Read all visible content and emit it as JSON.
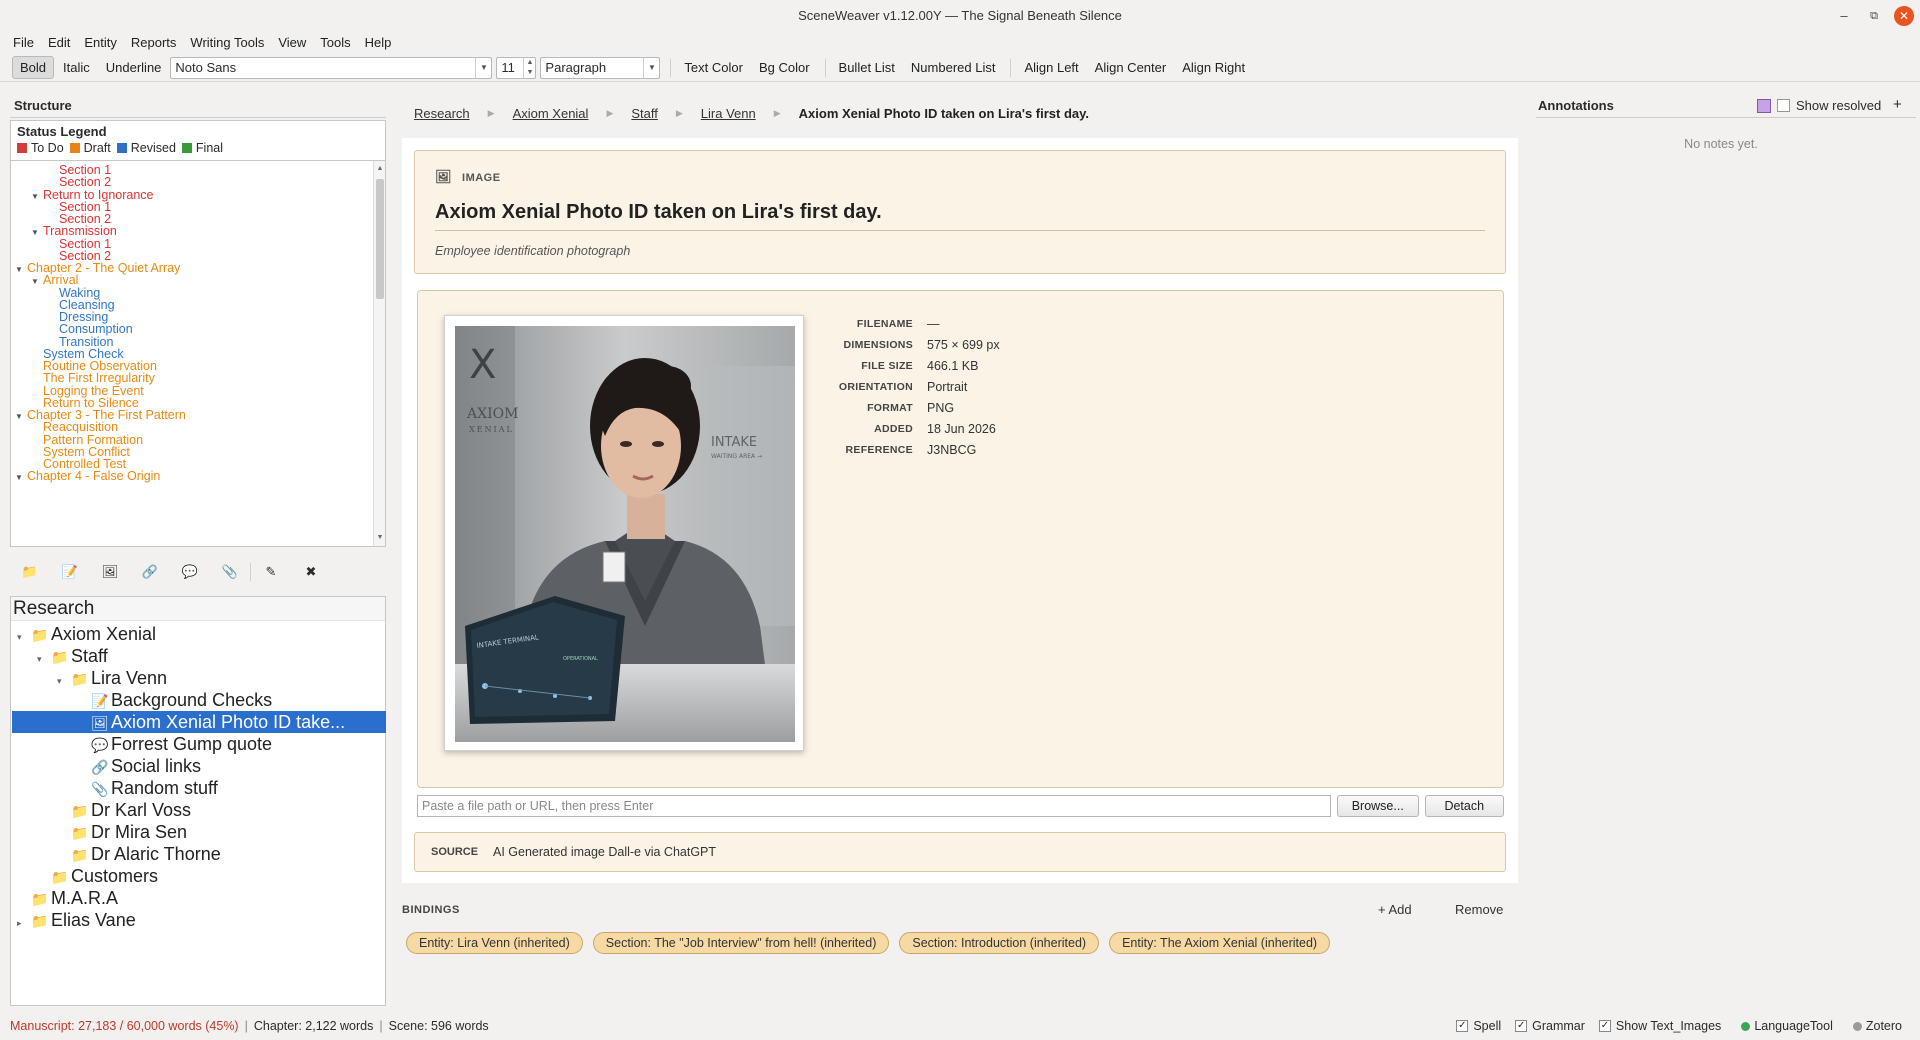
{
  "window": {
    "title": "SceneWeaver v1.12.00Y — The Signal Beneath Silence",
    "minimize": "–",
    "maximize": "⧉",
    "close": "✕"
  },
  "menu": [
    "File",
    "Edit",
    "Entity",
    "Reports",
    "Writing Tools",
    "View",
    "Tools",
    "Help"
  ],
  "toolbar": {
    "bold": "Bold",
    "italic": "Italic",
    "underline": "Underline",
    "font": "Noto Sans",
    "size": "11",
    "style": "Paragraph",
    "text_color": "Text Color",
    "bg_color": "Bg Color",
    "bullet_list": "Bullet List",
    "numbered_list": "Numbered List",
    "align_left": "Align Left",
    "align_center": "Align Center",
    "align_right": "Align Right"
  },
  "structure": {
    "header": "Structure",
    "legend_title": "Status Legend",
    "legend": [
      {
        "label": "To Do",
        "color": "#d33c3c"
      },
      {
        "label": "Draft",
        "color": "#e8821a"
      },
      {
        "label": "Revised",
        "color": "#2f6fc4"
      },
      {
        "label": "Final",
        "color": "#3a9a3a"
      }
    ],
    "items": [
      {
        "label": "Section 1",
        "level": 3,
        "color": "red",
        "expander": false
      },
      {
        "label": "Section 2",
        "level": 3,
        "color": "red",
        "expander": false
      },
      {
        "label": "Return to Ignorance",
        "level": 2,
        "color": "red",
        "expander": true
      },
      {
        "label": "Section 1",
        "level": 3,
        "color": "red",
        "expander": false
      },
      {
        "label": "Section 2",
        "level": 3,
        "color": "red",
        "expander": false
      },
      {
        "label": "Transmission",
        "level": 2,
        "color": "red",
        "expander": true
      },
      {
        "label": "Section 1",
        "level": 3,
        "color": "red",
        "expander": false
      },
      {
        "label": "Section 2",
        "level": 3,
        "color": "red",
        "expander": false
      },
      {
        "label": "Chapter 2 - The Quiet Array",
        "level": 1,
        "color": "orange",
        "expander": true
      },
      {
        "label": "Arrival",
        "level": 2,
        "color": "orange",
        "expander": true
      },
      {
        "label": "Waking",
        "level": 3,
        "color": "blue",
        "expander": false
      },
      {
        "label": "Cleansing",
        "level": 3,
        "color": "blue",
        "expander": false
      },
      {
        "label": "Dressing",
        "level": 3,
        "color": "blue",
        "expander": false
      },
      {
        "label": "Consumption",
        "level": 3,
        "color": "blue",
        "expander": false
      },
      {
        "label": "Transition",
        "level": 3,
        "color": "blue",
        "expander": false
      },
      {
        "label": "System Check",
        "level": 2,
        "color": "blue",
        "expander": false
      },
      {
        "label": "Routine Observation",
        "level": 2,
        "color": "orange",
        "expander": false
      },
      {
        "label": "The First Irregularity",
        "level": 2,
        "color": "orange",
        "expander": false
      },
      {
        "label": "Logging the Event",
        "level": 2,
        "color": "orange",
        "expander": false
      },
      {
        "label": "Return to Silence",
        "level": 2,
        "color": "orange",
        "expander": false
      },
      {
        "label": "Chapter 3 - The First Pattern",
        "level": 1,
        "color": "orange",
        "expander": true
      },
      {
        "label": "Reacquisition",
        "level": 2,
        "color": "orange",
        "expander": false
      },
      {
        "label": "Pattern Formation",
        "level": 2,
        "color": "orange",
        "expander": false
      },
      {
        "label": "System Conflict",
        "level": 2,
        "color": "orange",
        "expander": false
      },
      {
        "label": "Controlled Test",
        "level": 2,
        "color": "orange",
        "expander": false
      },
      {
        "label": "Chapter 4 - False Origin",
        "level": 1,
        "color": "orange",
        "expander": true
      }
    ]
  },
  "icon_bar": [
    {
      "name": "folder-icon",
      "glyph": "📁"
    },
    {
      "name": "note-icon",
      "glyph": "📝"
    },
    {
      "name": "image-icon",
      "glyph": "🖼"
    },
    {
      "name": "link-icon",
      "glyph": "🔗"
    },
    {
      "name": "quote-icon",
      "glyph": "💬"
    },
    {
      "name": "attachment-icon",
      "glyph": "📎"
    },
    {
      "name": "edit-icon",
      "glyph": "✎"
    },
    {
      "name": "delete-icon",
      "glyph": "✖"
    }
  ],
  "research": {
    "header": "Research",
    "items": [
      {
        "label": "Axiom Xenial",
        "indent": 0,
        "icon": "📁",
        "expander": "▾",
        "selected": false
      },
      {
        "label": "Staff",
        "indent": 1,
        "icon": "📁",
        "expander": "▾",
        "selected": false
      },
      {
        "label": "Lira Venn",
        "indent": 2,
        "icon": "📁",
        "expander": "▾",
        "selected": false
      },
      {
        "label": "Background Checks",
        "indent": 3,
        "icon": "📝",
        "expander": "",
        "selected": false
      },
      {
        "label": "Axiom Xenial Photo ID take...",
        "indent": 3,
        "icon": "🖼",
        "expander": "",
        "selected": true
      },
      {
        "label": "Forrest Gump quote",
        "indent": 3,
        "icon": "💬",
        "expander": "",
        "selected": false
      },
      {
        "label": "Social links",
        "indent": 3,
        "icon": "🔗",
        "expander": "",
        "selected": false
      },
      {
        "label": "Random stuff",
        "indent": 3,
        "icon": "📎",
        "expander": "",
        "selected": false
      },
      {
        "label": "Dr Karl Voss",
        "indent": 2,
        "icon": "📁",
        "expander": "",
        "selected": false
      },
      {
        "label": "Dr Mira Sen",
        "indent": 2,
        "icon": "📁",
        "expander": "",
        "selected": false
      },
      {
        "label": "Dr Alaric Thorne",
        "indent": 2,
        "icon": "📁",
        "expander": "",
        "selected": false
      },
      {
        "label": "Customers",
        "indent": 1,
        "icon": "📁",
        "expander": "",
        "selected": false
      },
      {
        "label": "M.A.R.A",
        "indent": 0,
        "icon": "📁",
        "expander": "",
        "selected": false
      },
      {
        "label": "Elias Vane",
        "indent": 0,
        "icon": "📁",
        "expander": "▸",
        "selected": false
      }
    ]
  },
  "breadcrumbs": [
    "Research",
    "Axiom Xenial",
    "Staff",
    "Lira Venn"
  ],
  "breadcrumb_current": "Axiom Xenial Photo ID taken on Lira's first day.",
  "image_card": {
    "kind": "IMAGE",
    "title": "Axiom Xenial Photo ID taken on Lira's first day.",
    "subtitle": "Employee identification photograph"
  },
  "photo_text": {
    "logo_line1": "AXIOM",
    "logo_line2": "XENIAL",
    "wall_sign": "INTAKE",
    "wall_sub": "WAITING AREA →",
    "terminal": "INTAKE TERMINAL",
    "terminal_status": "OPERATIONAL"
  },
  "meta": [
    {
      "key": "FILENAME",
      "value": "—"
    },
    {
      "key": "DIMENSIONS",
      "value": "575 × 699 px"
    },
    {
      "key": "FILE SIZE",
      "value": "466.1 KB"
    },
    {
      "key": "ORIENTATION",
      "value": "Portrait"
    },
    {
      "key": "FORMAT",
      "value": "PNG"
    },
    {
      "key": "ADDED",
      "value": "18 Jun 2026"
    },
    {
      "key": "REFERENCE",
      "value": "J3NBCG"
    }
  ],
  "path_input": {
    "placeholder": "Paste a file path or URL, then press Enter"
  },
  "browse_label": "Browse...",
  "detach_label": "Detach",
  "source": {
    "key": "SOURCE",
    "value": "AI Generated image Dall-e via ChatGPT"
  },
  "bindings": {
    "label": "BINDINGS",
    "add": "+ Add",
    "remove": "Remove",
    "chips": [
      "Entity: Lira Venn  (inherited)",
      "Section: The \"Job Interview\" from hell!  (inherited)",
      "Section: Introduction  (inherited)",
      "Entity: The Axiom Xenial  (inherited)"
    ]
  },
  "annotations": {
    "title": "Annotations",
    "show_resolved": "Show resolved",
    "add": "+",
    "empty": "No notes yet."
  },
  "status": {
    "manuscript": "Manuscript: 27,183 / 60,000 words (45%)",
    "chapter": "Chapter: 2,122 words",
    "scene": "Scene: 596 words",
    "spell": "Spell",
    "grammar": "Grammar",
    "show_text_images": "Show Text_Images",
    "languagetool": "LanguageTool",
    "zotero": "Zotero"
  },
  "colors": {
    "accent": "#2a6fce",
    "card_bg": "#fbf4e6",
    "chip_bg": "#f6d9a3"
  }
}
